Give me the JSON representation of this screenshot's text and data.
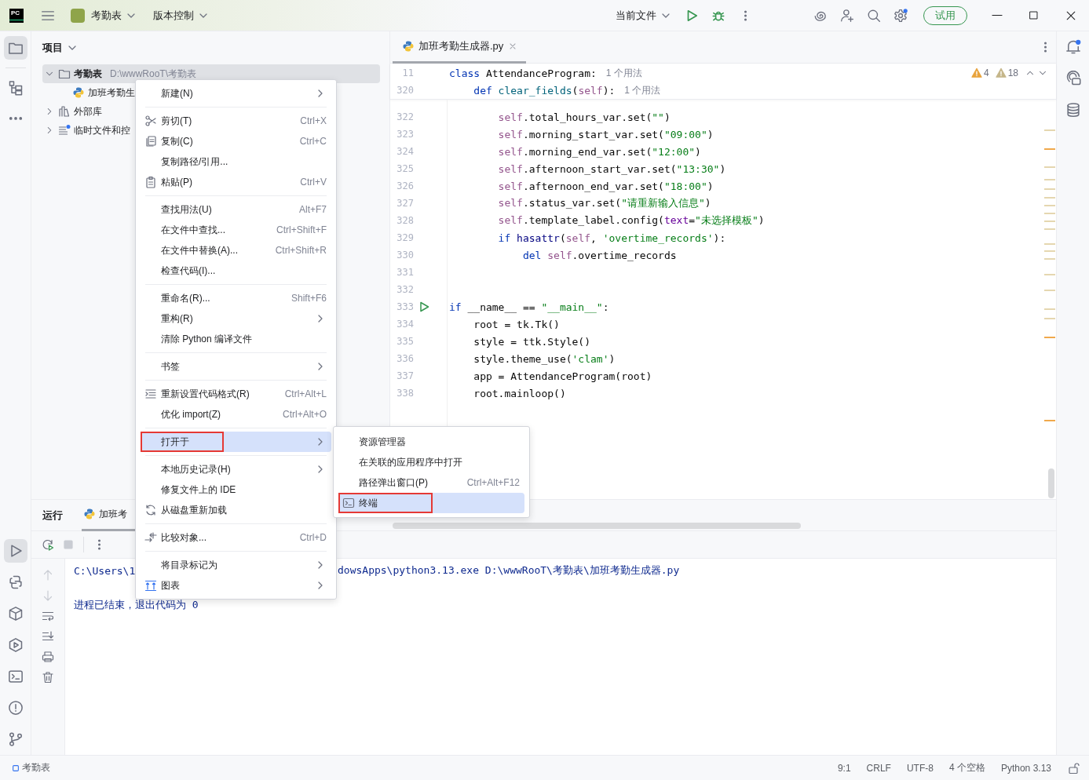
{
  "title_bar": {
    "logo": "PC",
    "project": "考勤表",
    "vcs": "版本控制",
    "run_config": "当前文件",
    "trial_button": "试用"
  },
  "left_tools_top": [
    {
      "kind": "project",
      "selected": true
    },
    {
      "kind": "structure",
      "selected": false
    },
    {
      "kind": "more",
      "selected": false
    }
  ],
  "left_tools_bottom": [
    {
      "kind": "run",
      "selected": true
    },
    {
      "kind": "python-console",
      "selected": false
    },
    {
      "kind": "packages",
      "selected": false
    },
    {
      "kind": "services",
      "selected": false
    },
    {
      "kind": "terminal",
      "selected": false
    },
    {
      "kind": "problems",
      "selected": false
    },
    {
      "kind": "git",
      "selected": false
    }
  ],
  "right_tools": [
    {
      "kind": "notifications"
    },
    {
      "kind": "assistant"
    },
    {
      "kind": "database"
    }
  ],
  "project_panel": {
    "title": "项目",
    "tree": [
      {
        "label": "考勤表",
        "path": "D:\\wwwRooT\\考勤表",
        "kind": "folder",
        "expanded": true,
        "selected": true,
        "children": [
          {
            "label": "加班考勤生",
            "kind": "python",
            "selected": false
          }
        ]
      },
      {
        "label": "外部库",
        "kind": "library",
        "expanded": false,
        "selected": false
      },
      {
        "label": "临时文件和控",
        "kind": "scratch",
        "expanded": false,
        "selected": false
      }
    ]
  },
  "editor": {
    "tab": {
      "label": "加班考勤生成器.py",
      "selected": true
    },
    "inspections": {
      "warnings": "4",
      "weak_warnings": "18"
    },
    "sticky": [
      {
        "number": "11",
        "tokens": [
          {
            "kind": "kw",
            "text": "class"
          },
          {
            "kind": "p",
            "text": " AttendanceProgram:"
          }
        ],
        "hint": "1 个用法"
      },
      {
        "number": "320",
        "tokens": [
          {
            "kind": "kw",
            "text": "    def"
          },
          {
            "kind": "fn",
            "text": " clear_fields"
          },
          {
            "kind": "p",
            "text": "("
          },
          {
            "kind": "self",
            "text": "self"
          },
          {
            "kind": "p",
            "text": "):"
          }
        ],
        "hint": "1 个用法"
      }
    ],
    "lines": [
      {
        "number": "322",
        "run": false,
        "tokens": [
          {
            "kind": "self",
            "text": "        self"
          },
          {
            "kind": "p",
            "text": ".total_hours_var.set("
          },
          {
            "kind": "str",
            "text": "\"\""
          },
          {
            "kind": "p",
            "text": ")"
          }
        ]
      },
      {
        "number": "323",
        "run": false,
        "tokens": [
          {
            "kind": "self",
            "text": "        self"
          },
          {
            "kind": "p",
            "text": ".morning_start_var.set("
          },
          {
            "kind": "str",
            "text": "\"09:00\""
          },
          {
            "kind": "p",
            "text": ")"
          }
        ]
      },
      {
        "number": "324",
        "run": false,
        "tokens": [
          {
            "kind": "self",
            "text": "        self"
          },
          {
            "kind": "p",
            "text": ".morning_end_var.set("
          },
          {
            "kind": "str",
            "text": "\"12:00\""
          },
          {
            "kind": "p",
            "text": ")"
          }
        ]
      },
      {
        "number": "325",
        "run": false,
        "tokens": [
          {
            "kind": "self",
            "text": "        self"
          },
          {
            "kind": "p",
            "text": ".afternoon_start_var.set("
          },
          {
            "kind": "str",
            "text": "\"13:30\""
          },
          {
            "kind": "p",
            "text": ")"
          }
        ]
      },
      {
        "number": "326",
        "run": false,
        "tokens": [
          {
            "kind": "self",
            "text": "        self"
          },
          {
            "kind": "p",
            "text": ".afternoon_end_var.set("
          },
          {
            "kind": "str",
            "text": "\"18:00\""
          },
          {
            "kind": "p",
            "text": ")"
          }
        ]
      },
      {
        "number": "327",
        "run": false,
        "tokens": [
          {
            "kind": "self",
            "text": "        self"
          },
          {
            "kind": "p",
            "text": ".status_var.set("
          },
          {
            "kind": "str",
            "text": "\"请重新输入信息\""
          },
          {
            "kind": "p",
            "text": ")"
          }
        ]
      },
      {
        "number": "328",
        "run": false,
        "tokens": [
          {
            "kind": "self",
            "text": "        self"
          },
          {
            "kind": "p",
            "text": ".template_label.config("
          },
          {
            "kind": "param",
            "text": "text"
          },
          {
            "kind": "p",
            "text": "="
          },
          {
            "kind": "str",
            "text": "\"未选择模板\""
          },
          {
            "kind": "p",
            "text": ")"
          }
        ]
      },
      {
        "number": "329",
        "run": false,
        "tokens": [
          {
            "kind": "kw",
            "text": "        if"
          },
          {
            "kind": "builtin",
            "text": " hasattr"
          },
          {
            "kind": "p",
            "text": "("
          },
          {
            "kind": "self",
            "text": "self"
          },
          {
            "kind": "p",
            "text": ", "
          },
          {
            "kind": "str",
            "text": "'overtime_records'"
          },
          {
            "kind": "p",
            "text": "):"
          }
        ]
      },
      {
        "number": "330",
        "run": false,
        "tokens": [
          {
            "kind": "kw",
            "text": "            del"
          },
          {
            "kind": "self",
            "text": " self"
          },
          {
            "kind": "p",
            "text": ".overtime_records"
          }
        ]
      },
      {
        "number": "331",
        "run": false
      },
      {
        "number": "332",
        "run": false
      },
      {
        "number": "333",
        "run": true,
        "tokens": [
          {
            "kind": "kw",
            "text": "if"
          },
          {
            "kind": "p",
            "text": " __name__ == "
          },
          {
            "kind": "str",
            "text": "\"__main__\""
          },
          {
            "kind": "p",
            "text": ":"
          }
        ]
      },
      {
        "number": "334",
        "run": false,
        "tokens": [
          {
            "kind": "p",
            "text": "    root = tk.Tk()"
          }
        ]
      },
      {
        "number": "335",
        "run": false,
        "tokens": [
          {
            "kind": "p",
            "text": "    style = ttk.Style()"
          }
        ]
      },
      {
        "number": "336",
        "run": false,
        "tokens": [
          {
            "kind": "p",
            "text": "    style.theme_use("
          },
          {
            "kind": "str",
            "text": "'clam'"
          },
          {
            "kind": "p",
            "text": ")"
          }
        ]
      },
      {
        "number": "337",
        "run": false,
        "tokens": [
          {
            "kind": "p",
            "text": "    app = AttendanceProgram(root)"
          }
        ]
      },
      {
        "number": "338",
        "run": false,
        "tokens": [
          {
            "kind": "p",
            "text": "    root.mainloop()"
          }
        ]
      }
    ]
  },
  "run_panel": {
    "title": "运行",
    "tab": {
      "label": "加班考",
      "selected": true
    },
    "console": [
      {
        "kind": "command",
        "parts": [
          "C:\\Users\\1",
          "dowsApps\\python3.13.exe D:\\wwwRooT\\考勤表\\加班考勤生成器.py"
        ]
      },
      {
        "kind": "info",
        "parts": [
          "进程已结束，退出代码为 0"
        ]
      }
    ]
  },
  "context_menu": {
    "groups": [
      [
        {
          "label": "新建(N)",
          "kind": "plain",
          "submenu": true,
          "selected": false,
          "outlined": false
        }
      ],
      [
        {
          "label": "剪切(T)",
          "shortcut": "Ctrl+X",
          "kind": "cut",
          "submenu": false,
          "selected": false,
          "outlined": false
        },
        {
          "label": "复制(C)",
          "shortcut": "Ctrl+C",
          "kind": "copy",
          "submenu": false,
          "selected": false,
          "outlined": false
        },
        {
          "label": "复制路径/引用...",
          "kind": "plain",
          "submenu": false,
          "selected": false,
          "outlined": false
        },
        {
          "label": "粘贴(P)",
          "shortcut": "Ctrl+V",
          "kind": "paste",
          "submenu": false,
          "selected": false,
          "outlined": false
        }
      ],
      [
        {
          "label": "查找用法(U)",
          "shortcut": "Alt+F7",
          "kind": "plain",
          "submenu": false,
          "selected": false,
          "outlined": false
        },
        {
          "label": "在文件中查找...",
          "shortcut": "Ctrl+Shift+F",
          "kind": "plain",
          "submenu": false,
          "selected": false,
          "outlined": false
        },
        {
          "label": "在文件中替换(A)...",
          "shortcut": "Ctrl+Shift+R",
          "kind": "plain",
          "submenu": false,
          "selected": false,
          "outlined": false
        },
        {
          "label": "检查代码(I)...",
          "kind": "plain",
          "submenu": false,
          "selected": false,
          "outlined": false
        }
      ],
      [
        {
          "label": "重命名(R)...",
          "shortcut": "Shift+F6",
          "kind": "plain",
          "submenu": false,
          "selected": false,
          "outlined": false
        },
        {
          "label": "重构(R)",
          "kind": "plain",
          "submenu": true,
          "selected": false,
          "outlined": false
        },
        {
          "label": "清除 Python 编译文件",
          "kind": "plain",
          "submenu": false,
          "selected": false,
          "outlined": false
        }
      ],
      [
        {
          "label": "书签",
          "kind": "plain",
          "submenu": true,
          "selected": false,
          "outlined": false
        }
      ],
      [
        {
          "label": "重新设置代码格式(R)",
          "shortcut": "Ctrl+Alt+L",
          "kind": "format",
          "submenu": false,
          "selected": false,
          "outlined": false
        },
        {
          "label": "优化 import(Z)",
          "shortcut": "Ctrl+Alt+O",
          "kind": "plain",
          "submenu": false,
          "selected": false,
          "outlined": false
        }
      ],
      [
        {
          "label": "打开于",
          "kind": "plain",
          "submenu": true,
          "selected": true,
          "outlined": true
        }
      ],
      [
        {
          "label": "本地历史记录(H)",
          "kind": "plain",
          "submenu": true,
          "selected": false,
          "outlined": false
        },
        {
          "label": "修复文件上的 IDE",
          "kind": "plain",
          "submenu": false,
          "selected": false,
          "outlined": false
        },
        {
          "label": "从磁盘重新加载",
          "kind": "reload",
          "submenu": false,
          "selected": false,
          "outlined": false
        }
      ],
      [
        {
          "label": "比较对象...",
          "shortcut": "Ctrl+D",
          "kind": "compare",
          "submenu": false,
          "selected": false,
          "outlined": false
        }
      ],
      [
        {
          "label": "将目录标记为",
          "kind": "plain",
          "submenu": true,
          "selected": false,
          "outlined": false
        },
        {
          "label": "图表",
          "kind": "chart",
          "submenu": true,
          "selected": false,
          "outlined": false
        }
      ]
    ]
  },
  "submenu": {
    "items": [
      {
        "label": "资源管理器",
        "kind": "plain",
        "submenu": false,
        "selected": false,
        "outlined": false
      },
      {
        "label": "在关联的应用程序中打开",
        "kind": "plain",
        "submenu": false,
        "selected": false,
        "outlined": false
      },
      {
        "label": "路径弹出窗口(P)",
        "shortcut": "Ctrl+Alt+F12",
        "kind": "plain",
        "submenu": false,
        "selected": false,
        "outlined": false
      },
      {
        "label": "终端",
        "kind": "terminal",
        "submenu": false,
        "selected": true,
        "outlined": true
      }
    ]
  },
  "status_bar": {
    "project": "考勤表",
    "items": [
      "9:1",
      "CRLF",
      "UTF-8",
      "4 个空格",
      "Python 3.13"
    ]
  }
}
